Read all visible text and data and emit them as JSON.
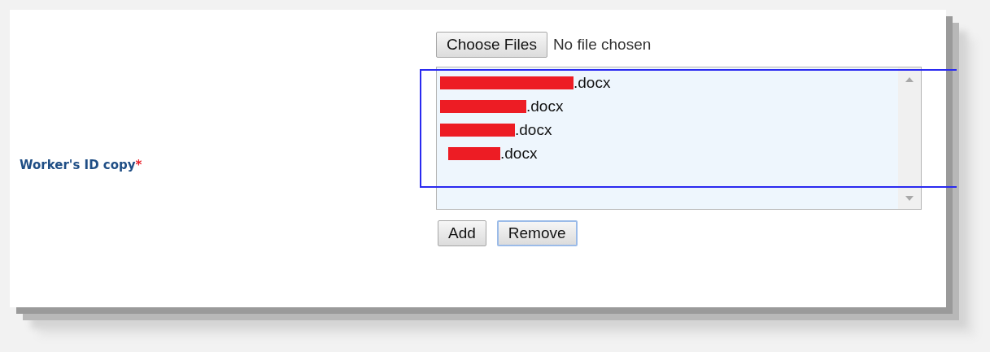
{
  "field": {
    "label": "Worker's ID copy",
    "required_mark": "*"
  },
  "file_input": {
    "button": "Choose Files",
    "status": "No file chosen"
  },
  "file_list": {
    "items": [
      {
        "text": ".docx",
        "redacted": true
      },
      {
        "text": ".docx",
        "redacted": true
      },
      {
        "text": ".docx",
        "redacted": true
      },
      {
        "text": ".docx",
        "redacted": true
      }
    ]
  },
  "buttons": [
    {
      "label": "Add",
      "focused": false
    },
    {
      "label": "Remove",
      "focused": true
    }
  ],
  "highlight_box": true
}
